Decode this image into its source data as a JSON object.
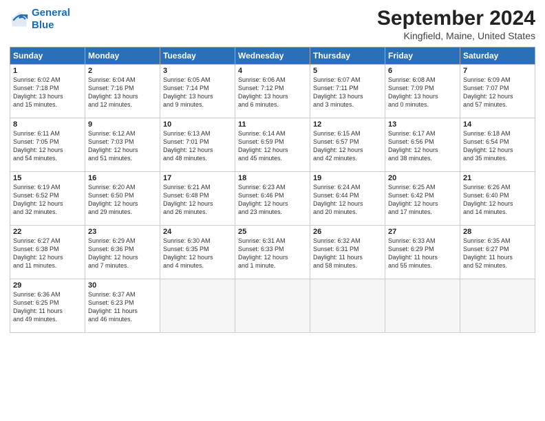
{
  "logo": {
    "line1": "General",
    "line2": "Blue"
  },
  "title": "September 2024",
  "location": "Kingfield, Maine, United States",
  "days_of_week": [
    "Sunday",
    "Monday",
    "Tuesday",
    "Wednesday",
    "Thursday",
    "Friday",
    "Saturday"
  ],
  "weeks": [
    [
      {
        "day": "1",
        "content": "Sunrise: 6:02 AM\nSunset: 7:18 PM\nDaylight: 13 hours\nand 15 minutes."
      },
      {
        "day": "2",
        "content": "Sunrise: 6:04 AM\nSunset: 7:16 PM\nDaylight: 13 hours\nand 12 minutes."
      },
      {
        "day": "3",
        "content": "Sunrise: 6:05 AM\nSunset: 7:14 PM\nDaylight: 13 hours\nand 9 minutes."
      },
      {
        "day": "4",
        "content": "Sunrise: 6:06 AM\nSunset: 7:12 PM\nDaylight: 13 hours\nand 6 minutes."
      },
      {
        "day": "5",
        "content": "Sunrise: 6:07 AM\nSunset: 7:11 PM\nDaylight: 13 hours\nand 3 minutes."
      },
      {
        "day": "6",
        "content": "Sunrise: 6:08 AM\nSunset: 7:09 PM\nDaylight: 13 hours\nand 0 minutes."
      },
      {
        "day": "7",
        "content": "Sunrise: 6:09 AM\nSunset: 7:07 PM\nDaylight: 12 hours\nand 57 minutes."
      }
    ],
    [
      {
        "day": "8",
        "content": "Sunrise: 6:11 AM\nSunset: 7:05 PM\nDaylight: 12 hours\nand 54 minutes."
      },
      {
        "day": "9",
        "content": "Sunrise: 6:12 AM\nSunset: 7:03 PM\nDaylight: 12 hours\nand 51 minutes."
      },
      {
        "day": "10",
        "content": "Sunrise: 6:13 AM\nSunset: 7:01 PM\nDaylight: 12 hours\nand 48 minutes."
      },
      {
        "day": "11",
        "content": "Sunrise: 6:14 AM\nSunset: 6:59 PM\nDaylight: 12 hours\nand 45 minutes."
      },
      {
        "day": "12",
        "content": "Sunrise: 6:15 AM\nSunset: 6:57 PM\nDaylight: 12 hours\nand 42 minutes."
      },
      {
        "day": "13",
        "content": "Sunrise: 6:17 AM\nSunset: 6:56 PM\nDaylight: 12 hours\nand 38 minutes."
      },
      {
        "day": "14",
        "content": "Sunrise: 6:18 AM\nSunset: 6:54 PM\nDaylight: 12 hours\nand 35 minutes."
      }
    ],
    [
      {
        "day": "15",
        "content": "Sunrise: 6:19 AM\nSunset: 6:52 PM\nDaylight: 12 hours\nand 32 minutes."
      },
      {
        "day": "16",
        "content": "Sunrise: 6:20 AM\nSunset: 6:50 PM\nDaylight: 12 hours\nand 29 minutes."
      },
      {
        "day": "17",
        "content": "Sunrise: 6:21 AM\nSunset: 6:48 PM\nDaylight: 12 hours\nand 26 minutes."
      },
      {
        "day": "18",
        "content": "Sunrise: 6:23 AM\nSunset: 6:46 PM\nDaylight: 12 hours\nand 23 minutes."
      },
      {
        "day": "19",
        "content": "Sunrise: 6:24 AM\nSunset: 6:44 PM\nDaylight: 12 hours\nand 20 minutes."
      },
      {
        "day": "20",
        "content": "Sunrise: 6:25 AM\nSunset: 6:42 PM\nDaylight: 12 hours\nand 17 minutes."
      },
      {
        "day": "21",
        "content": "Sunrise: 6:26 AM\nSunset: 6:40 PM\nDaylight: 12 hours\nand 14 minutes."
      }
    ],
    [
      {
        "day": "22",
        "content": "Sunrise: 6:27 AM\nSunset: 6:38 PM\nDaylight: 12 hours\nand 11 minutes."
      },
      {
        "day": "23",
        "content": "Sunrise: 6:29 AM\nSunset: 6:36 PM\nDaylight: 12 hours\nand 7 minutes."
      },
      {
        "day": "24",
        "content": "Sunrise: 6:30 AM\nSunset: 6:35 PM\nDaylight: 12 hours\nand 4 minutes."
      },
      {
        "day": "25",
        "content": "Sunrise: 6:31 AM\nSunset: 6:33 PM\nDaylight: 12 hours\nand 1 minute."
      },
      {
        "day": "26",
        "content": "Sunrise: 6:32 AM\nSunset: 6:31 PM\nDaylight: 11 hours\nand 58 minutes."
      },
      {
        "day": "27",
        "content": "Sunrise: 6:33 AM\nSunset: 6:29 PM\nDaylight: 11 hours\nand 55 minutes."
      },
      {
        "day": "28",
        "content": "Sunrise: 6:35 AM\nSunset: 6:27 PM\nDaylight: 11 hours\nand 52 minutes."
      }
    ],
    [
      {
        "day": "29",
        "content": "Sunrise: 6:36 AM\nSunset: 6:25 PM\nDaylight: 11 hours\nand 49 minutes."
      },
      {
        "day": "30",
        "content": "Sunrise: 6:37 AM\nSunset: 6:23 PM\nDaylight: 11 hours\nand 46 minutes."
      },
      {
        "day": "",
        "content": ""
      },
      {
        "day": "",
        "content": ""
      },
      {
        "day": "",
        "content": ""
      },
      {
        "day": "",
        "content": ""
      },
      {
        "day": "",
        "content": ""
      }
    ]
  ]
}
